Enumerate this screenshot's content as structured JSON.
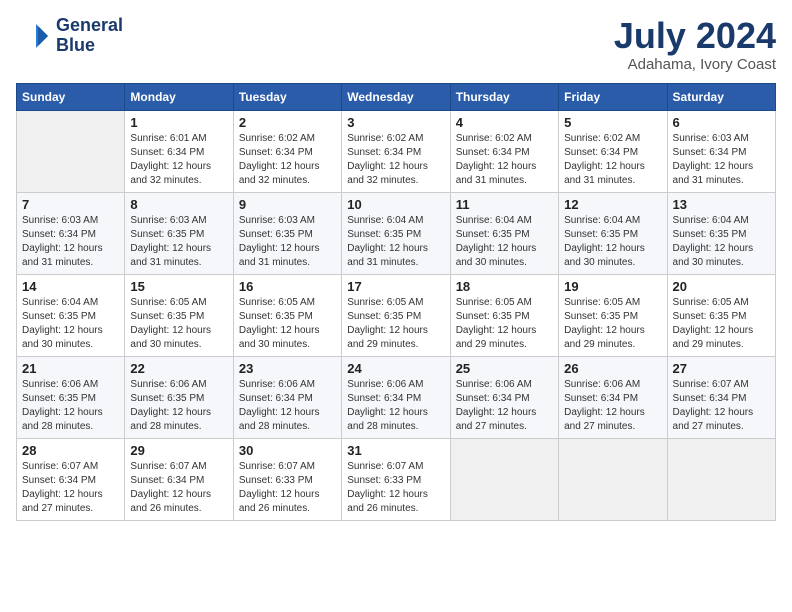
{
  "header": {
    "logo_line1": "General",
    "logo_line2": "Blue",
    "month_year": "July 2024",
    "location": "Adahama, Ivory Coast"
  },
  "weekdays": [
    "Sunday",
    "Monday",
    "Tuesday",
    "Wednesday",
    "Thursday",
    "Friday",
    "Saturday"
  ],
  "weeks": [
    [
      {
        "day": "",
        "info": ""
      },
      {
        "day": "1",
        "info": "Sunrise: 6:01 AM\nSunset: 6:34 PM\nDaylight: 12 hours\nand 32 minutes."
      },
      {
        "day": "2",
        "info": "Sunrise: 6:02 AM\nSunset: 6:34 PM\nDaylight: 12 hours\nand 32 minutes."
      },
      {
        "day": "3",
        "info": "Sunrise: 6:02 AM\nSunset: 6:34 PM\nDaylight: 12 hours\nand 32 minutes."
      },
      {
        "day": "4",
        "info": "Sunrise: 6:02 AM\nSunset: 6:34 PM\nDaylight: 12 hours\nand 31 minutes."
      },
      {
        "day": "5",
        "info": "Sunrise: 6:02 AM\nSunset: 6:34 PM\nDaylight: 12 hours\nand 31 minutes."
      },
      {
        "day": "6",
        "info": "Sunrise: 6:03 AM\nSunset: 6:34 PM\nDaylight: 12 hours\nand 31 minutes."
      }
    ],
    [
      {
        "day": "7",
        "info": "Sunrise: 6:03 AM\nSunset: 6:34 PM\nDaylight: 12 hours\nand 31 minutes."
      },
      {
        "day": "8",
        "info": "Sunrise: 6:03 AM\nSunset: 6:35 PM\nDaylight: 12 hours\nand 31 minutes."
      },
      {
        "day": "9",
        "info": "Sunrise: 6:03 AM\nSunset: 6:35 PM\nDaylight: 12 hours\nand 31 minutes."
      },
      {
        "day": "10",
        "info": "Sunrise: 6:04 AM\nSunset: 6:35 PM\nDaylight: 12 hours\nand 31 minutes."
      },
      {
        "day": "11",
        "info": "Sunrise: 6:04 AM\nSunset: 6:35 PM\nDaylight: 12 hours\nand 30 minutes."
      },
      {
        "day": "12",
        "info": "Sunrise: 6:04 AM\nSunset: 6:35 PM\nDaylight: 12 hours\nand 30 minutes."
      },
      {
        "day": "13",
        "info": "Sunrise: 6:04 AM\nSunset: 6:35 PM\nDaylight: 12 hours\nand 30 minutes."
      }
    ],
    [
      {
        "day": "14",
        "info": "Sunrise: 6:04 AM\nSunset: 6:35 PM\nDaylight: 12 hours\nand 30 minutes."
      },
      {
        "day": "15",
        "info": "Sunrise: 6:05 AM\nSunset: 6:35 PM\nDaylight: 12 hours\nand 30 minutes."
      },
      {
        "day": "16",
        "info": "Sunrise: 6:05 AM\nSunset: 6:35 PM\nDaylight: 12 hours\nand 30 minutes."
      },
      {
        "day": "17",
        "info": "Sunrise: 6:05 AM\nSunset: 6:35 PM\nDaylight: 12 hours\nand 29 minutes."
      },
      {
        "day": "18",
        "info": "Sunrise: 6:05 AM\nSunset: 6:35 PM\nDaylight: 12 hours\nand 29 minutes."
      },
      {
        "day": "19",
        "info": "Sunrise: 6:05 AM\nSunset: 6:35 PM\nDaylight: 12 hours\nand 29 minutes."
      },
      {
        "day": "20",
        "info": "Sunrise: 6:05 AM\nSunset: 6:35 PM\nDaylight: 12 hours\nand 29 minutes."
      }
    ],
    [
      {
        "day": "21",
        "info": "Sunrise: 6:06 AM\nSunset: 6:35 PM\nDaylight: 12 hours\nand 28 minutes."
      },
      {
        "day": "22",
        "info": "Sunrise: 6:06 AM\nSunset: 6:35 PM\nDaylight: 12 hours\nand 28 minutes."
      },
      {
        "day": "23",
        "info": "Sunrise: 6:06 AM\nSunset: 6:34 PM\nDaylight: 12 hours\nand 28 minutes."
      },
      {
        "day": "24",
        "info": "Sunrise: 6:06 AM\nSunset: 6:34 PM\nDaylight: 12 hours\nand 28 minutes."
      },
      {
        "day": "25",
        "info": "Sunrise: 6:06 AM\nSunset: 6:34 PM\nDaylight: 12 hours\nand 27 minutes."
      },
      {
        "day": "26",
        "info": "Sunrise: 6:06 AM\nSunset: 6:34 PM\nDaylight: 12 hours\nand 27 minutes."
      },
      {
        "day": "27",
        "info": "Sunrise: 6:07 AM\nSunset: 6:34 PM\nDaylight: 12 hours\nand 27 minutes."
      }
    ],
    [
      {
        "day": "28",
        "info": "Sunrise: 6:07 AM\nSunset: 6:34 PM\nDaylight: 12 hours\nand 27 minutes."
      },
      {
        "day": "29",
        "info": "Sunrise: 6:07 AM\nSunset: 6:34 PM\nDaylight: 12 hours\nand 26 minutes."
      },
      {
        "day": "30",
        "info": "Sunrise: 6:07 AM\nSunset: 6:33 PM\nDaylight: 12 hours\nand 26 minutes."
      },
      {
        "day": "31",
        "info": "Sunrise: 6:07 AM\nSunset: 6:33 PM\nDaylight: 12 hours\nand 26 minutes."
      },
      {
        "day": "",
        "info": ""
      },
      {
        "day": "",
        "info": ""
      },
      {
        "day": "",
        "info": ""
      }
    ]
  ]
}
